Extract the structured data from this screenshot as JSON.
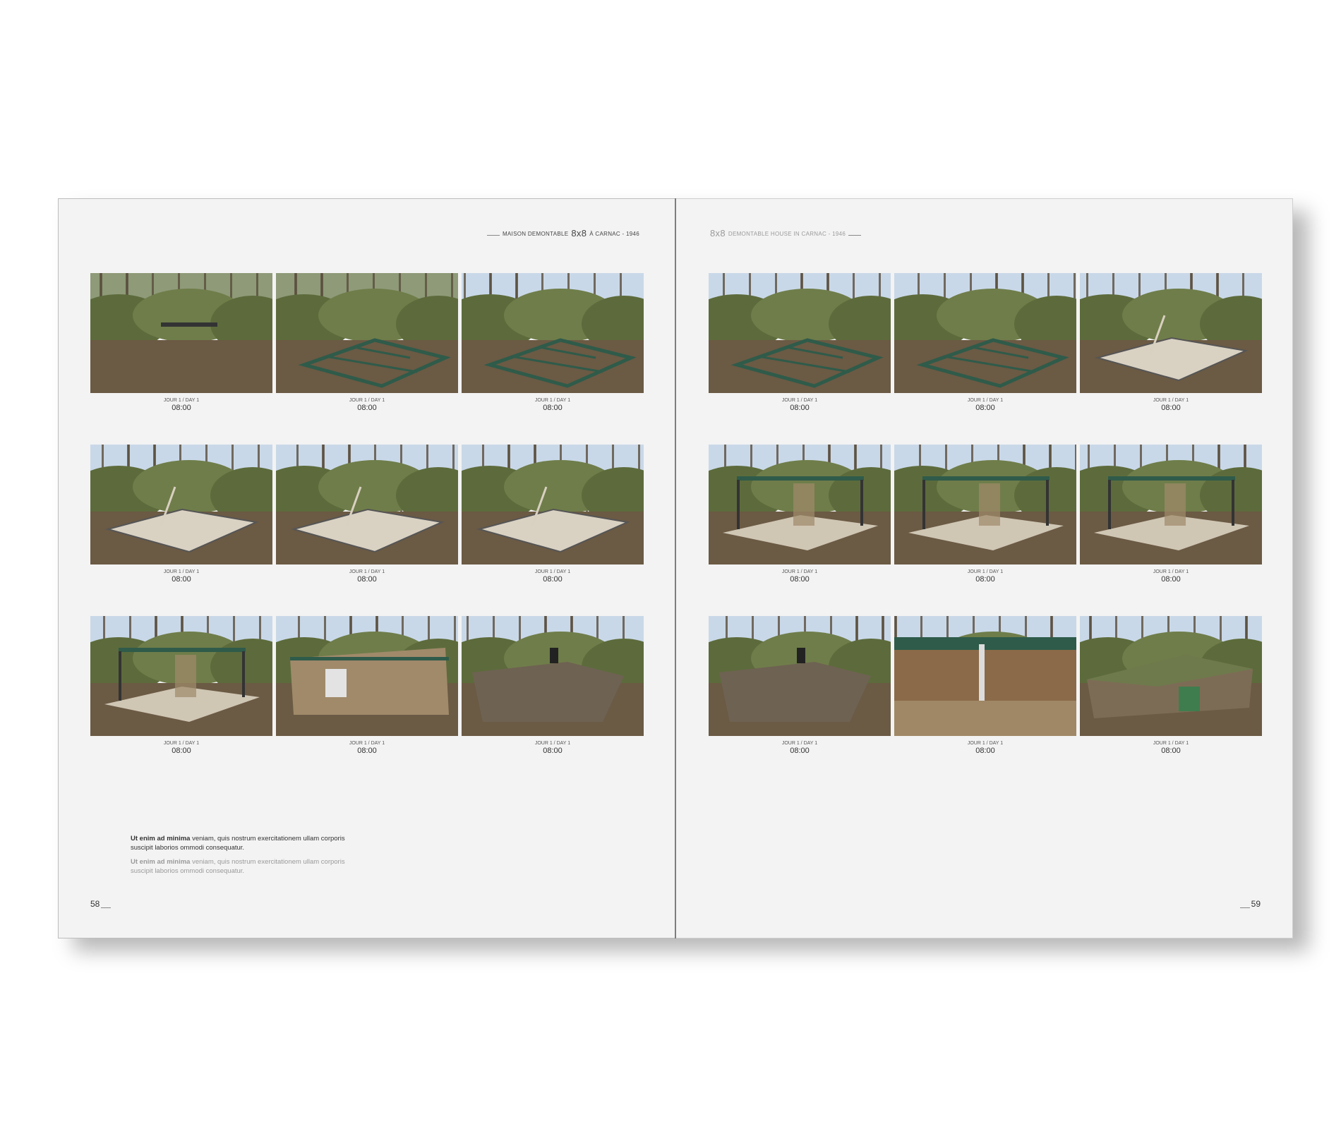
{
  "left_page": {
    "running_head": {
      "pre": "MAISON DEMONTABLE",
      "big": "8x8",
      "post": "À CARNAC - 1946"
    },
    "page_number": "58",
    "captions": [
      {
        "day": "JOUR 1 / DAY 1",
        "time": "08:00"
      },
      {
        "day": "JOUR 1 / DAY 1",
        "time": "08:00"
      },
      {
        "day": "JOUR 1 / DAY 1",
        "time": "08:00"
      },
      {
        "day": "JOUR 1 / DAY 1",
        "time": "08:00"
      },
      {
        "day": "JOUR 1 / DAY 1",
        "time": "08:00"
      },
      {
        "day": "JOUR 1 / DAY 1",
        "time": "08:00"
      },
      {
        "day": "JOUR 1 / DAY 1",
        "time": "08:00"
      },
      {
        "day": "JOUR 1 / DAY 1",
        "time": "08:00"
      },
      {
        "day": "JOUR 1 / DAY 1",
        "time": "08:00"
      }
    ],
    "note": {
      "p1_bold": "Ut enim ad minima",
      "p1_rest": " veniam, quis nostrum exercitationem ullam corporis suscipit laborios ommodi consequatur.",
      "p2_bold": "Ut enim ad minima",
      "p2_rest": " veniam, quis nostrum exercitationem ullam corporis suscipit laborios ommodi consequatur."
    }
  },
  "right_page": {
    "running_head": {
      "big": "8x8",
      "post": "DEMONTABLE HOUSE IN CARNAC - 1946"
    },
    "page_number": "59",
    "captions": [
      {
        "day": "JOUR 1 / DAY 1",
        "time": "08:00"
      },
      {
        "day": "JOUR 1 / DAY 1",
        "time": "08:00"
      },
      {
        "day": "JOUR 1 / DAY 1",
        "time": "08:00"
      },
      {
        "day": "JOUR 1 / DAY 1",
        "time": "08:00"
      },
      {
        "day": "JOUR 1 / DAY 1",
        "time": "08:00"
      },
      {
        "day": "JOUR 1 / DAY 1",
        "time": "08:00"
      },
      {
        "day": "JOUR 1 / DAY 1",
        "time": "08:00"
      },
      {
        "day": "JOUR 1 / DAY 1",
        "time": "08:00"
      },
      {
        "day": "JOUR 1 / DAY 1",
        "time": "08:00"
      }
    ]
  },
  "colors": {
    "page": "#f3f3f3",
    "foliage": "#5d6b3c",
    "ground": "#6b5a44",
    "sky": "#c9d8e8",
    "steel_green": "#2f5b4a",
    "timber": "#a08a6a"
  }
}
